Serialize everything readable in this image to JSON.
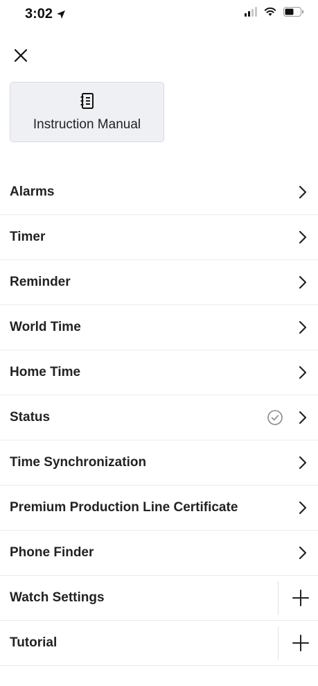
{
  "status_bar": {
    "time": "3:02"
  },
  "header": {
    "close_icon": "close-icon"
  },
  "manual": {
    "label": "Instruction Manual",
    "icon": "manual-icon"
  },
  "menu": {
    "items": [
      {
        "label": "Alarms",
        "trailing": "chevron"
      },
      {
        "label": "Timer",
        "trailing": "chevron"
      },
      {
        "label": "Reminder",
        "trailing": "chevron"
      },
      {
        "label": "World Time",
        "trailing": "chevron"
      },
      {
        "label": "Home Time",
        "trailing": "chevron"
      },
      {
        "label": "Status",
        "trailing": "chevron",
        "badge": "check-circle-icon"
      },
      {
        "label": "Time Synchronization",
        "trailing": "chevron"
      },
      {
        "label": "Premium Production Line Certificate",
        "trailing": "chevron"
      },
      {
        "label": "Phone Finder",
        "trailing": "chevron"
      },
      {
        "label": "Watch Settings",
        "trailing": "plus"
      },
      {
        "label": "Tutorial",
        "trailing": "plus"
      }
    ]
  },
  "colors": {
    "text": "#222222",
    "card_bg": "#eef0f3",
    "divider": "#ececec",
    "check": "#888888"
  }
}
